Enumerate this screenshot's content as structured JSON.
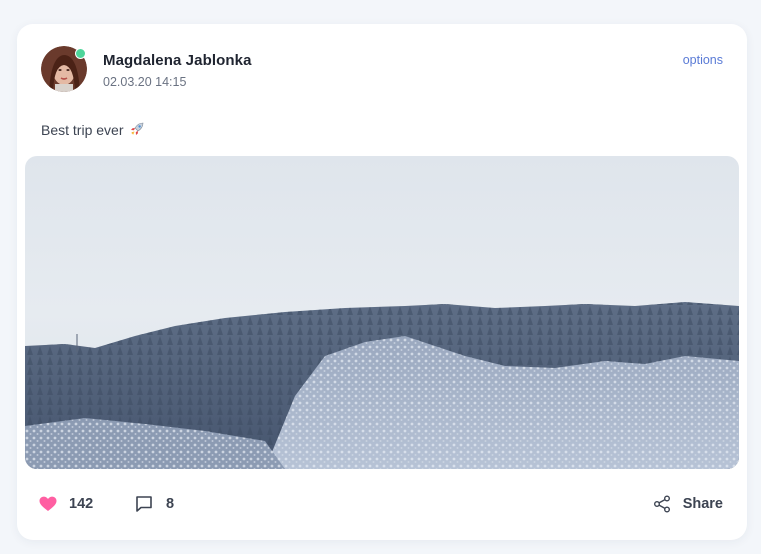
{
  "post": {
    "author": "Magdalena Jablonka",
    "timestamp": "02.03.20 14:15",
    "options_label": "options",
    "text": "Best trip ever",
    "text_emoji": "rocket-icon",
    "online": true
  },
  "actions": {
    "likes": "142",
    "comments": "8",
    "share_label": "Share"
  },
  "colors": {
    "background": "#f3f6fa",
    "card": "#ffffff",
    "accent": "#5a7bd6",
    "like": "#ff5fa2",
    "online": "#4ed59a"
  }
}
